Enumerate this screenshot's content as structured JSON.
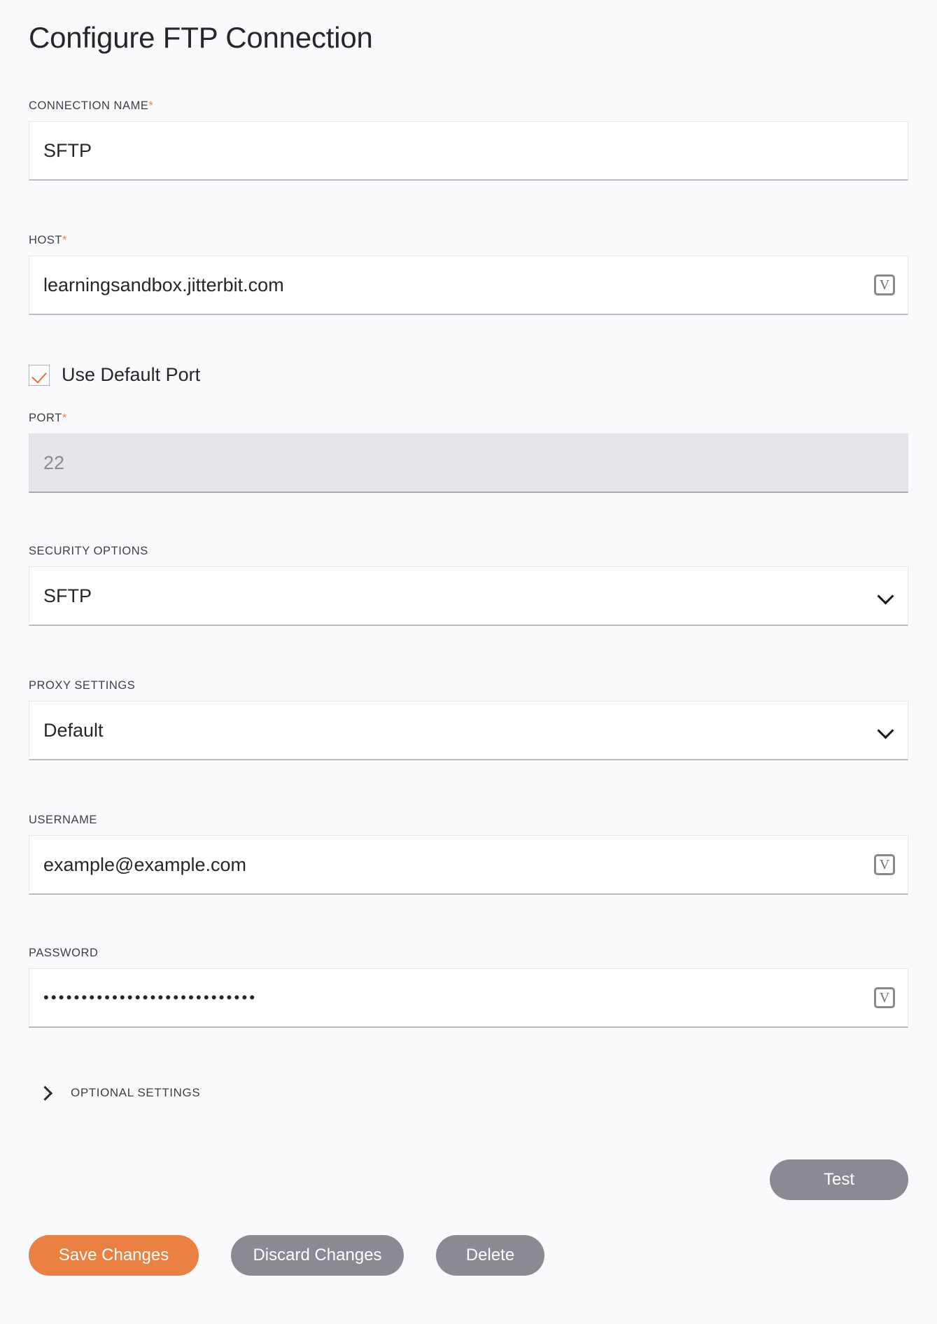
{
  "page": {
    "title": "Configure FTP Connection",
    "background_color": "#f9fafb",
    "accent_color": "#ea8042",
    "required_marker": "*"
  },
  "fields": {
    "connection_name": {
      "label": "CONNECTION NAME",
      "required": true,
      "value": "SFTP",
      "type": "text"
    },
    "host": {
      "label": "HOST",
      "required": true,
      "value": "learningsandbox.jitterbit.com",
      "type": "text",
      "variable_icon": "V"
    },
    "use_default_port": {
      "label": "Use Default Port",
      "checked": true,
      "check_color": "#e2703a"
    },
    "port": {
      "label": "PORT",
      "required": true,
      "value": "22",
      "type": "text",
      "disabled": true
    },
    "security_options": {
      "label": "SECURITY OPTIONS",
      "required": false,
      "value": "SFTP",
      "type": "select"
    },
    "proxy_settings": {
      "label": "PROXY SETTINGS",
      "required": false,
      "value": "Default",
      "type": "select"
    },
    "username": {
      "label": "USERNAME",
      "required": false,
      "value": "example@example.com",
      "type": "text",
      "variable_icon": "V"
    },
    "password": {
      "label": "PASSWORD",
      "required": false,
      "value": "••••••••••••••••••••••••••••",
      "type": "password",
      "variable_icon": "V"
    }
  },
  "optional_settings": {
    "label": "OPTIONAL SETTINGS",
    "expanded": false,
    "icon": "chevron-right-icon"
  },
  "actions": {
    "test": "Test",
    "save": "Save Changes",
    "discard": "Discard Changes",
    "delete": "Delete"
  }
}
